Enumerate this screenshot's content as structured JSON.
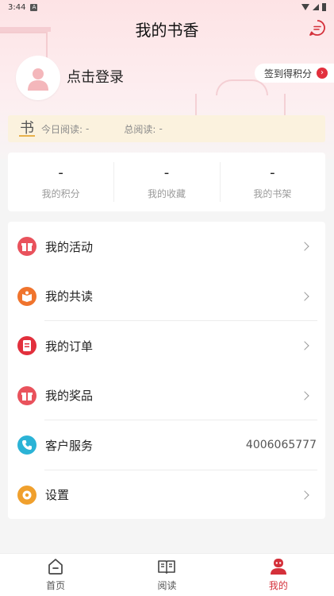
{
  "status_bar": {
    "time": "3:44",
    "badge": "A"
  },
  "header": {
    "title": "我的书香"
  },
  "login": {
    "text": "点击登录",
    "sign_label": "签到得积分"
  },
  "reading": {
    "book_glyph": "书",
    "today_label": "今日阅读:",
    "today_value": "-",
    "total_label": "总阅读:",
    "total_value": "-"
  },
  "stats": [
    {
      "value": "-",
      "label": "我的积分"
    },
    {
      "value": "-",
      "label": "我的收藏"
    },
    {
      "value": "-",
      "label": "我的书架"
    }
  ],
  "menu": [
    {
      "label": "我的活动",
      "icon": "gift-icon",
      "color": "#e9525c"
    },
    {
      "label": "我的共读",
      "icon": "book-group-icon",
      "color": "#f0742d"
    },
    {
      "label": "我的订单",
      "icon": "order-icon",
      "color": "#e2303d"
    },
    {
      "label": "我的奖品",
      "icon": "prize-icon",
      "color": "#e9525c"
    },
    {
      "label": "客户服务",
      "icon": "phone-icon",
      "color": "#2bb3d6",
      "value": "4006065777"
    },
    {
      "label": "设置",
      "icon": "settings-icon",
      "color": "#f0a02d"
    }
  ],
  "nav": [
    {
      "label": "首页",
      "icon": "home-icon"
    },
    {
      "label": "阅读",
      "icon": "open-book-icon"
    },
    {
      "label": "我的",
      "icon": "profile-icon",
      "active": true
    }
  ],
  "colors": {
    "accent": "#d4303a",
    "strip": "#fbf2de",
    "header_bg": "#fde3e5"
  }
}
